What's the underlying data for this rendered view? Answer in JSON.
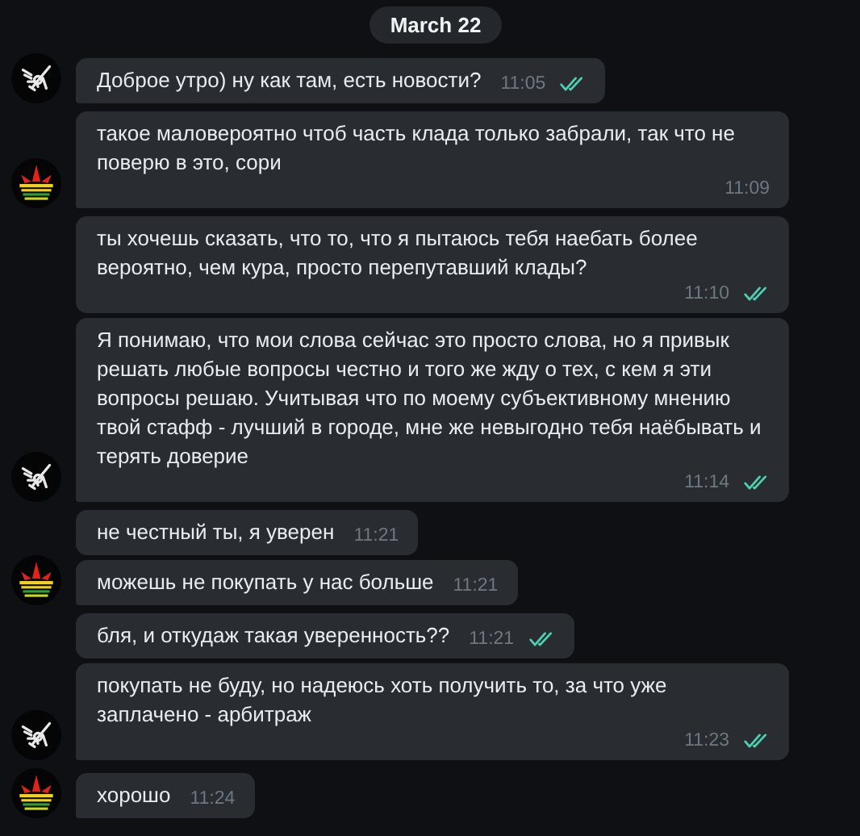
{
  "date": "March 22",
  "groups": [
    {
      "kind": "outgoing",
      "messages": [
        {
          "text": "Доброе утро) ну как там, есть новости?",
          "time": "11:05",
          "read": true
        }
      ]
    },
    {
      "kind": "incoming",
      "messages": [
        {
          "text": "такое маловероятно чтоб часть клада только забрали, так что не поверю в это, сори",
          "time": "11:09",
          "read": false
        }
      ]
    },
    {
      "kind": "outgoing",
      "messages": [
        {
          "text": "ты хочешь сказать, что то, что я пытаюсь тебя наебать более вероятно, чем кура, просто перепутавший клады?",
          "time": "11:10",
          "read": true
        },
        {
          "text": "Я понимаю, что мои слова сейчас это просто слова, но я привык решать любые вопросы честно и того же жду о тех, с кем я эти вопросы решаю. Учитывая что по моему субъективному мнению твой стафф - лучший в городе, мне же невыгодно тебя наёбывать и терять доверие",
          "time": "11:14",
          "read": true
        }
      ]
    },
    {
      "kind": "incoming",
      "messages": [
        {
          "text": "не честный ты, я уверен",
          "time": "11:21",
          "read": false
        },
        {
          "text": "можешь не покупать у нас больше",
          "time": "11:21",
          "read": false
        }
      ]
    },
    {
      "kind": "outgoing",
      "messages": [
        {
          "text": "бля, и откудаж такая уверенность??",
          "time": "11:21",
          "read": true
        },
        {
          "text": "покупать не буду, но надеюсь хоть получить то, за что уже заплачено - арбитраж",
          "time": "11:23",
          "read": true
        }
      ]
    },
    {
      "kind": "incoming",
      "messages": [
        {
          "text": "хорошо",
          "time": "11:24",
          "read": false
        }
      ]
    }
  ]
}
